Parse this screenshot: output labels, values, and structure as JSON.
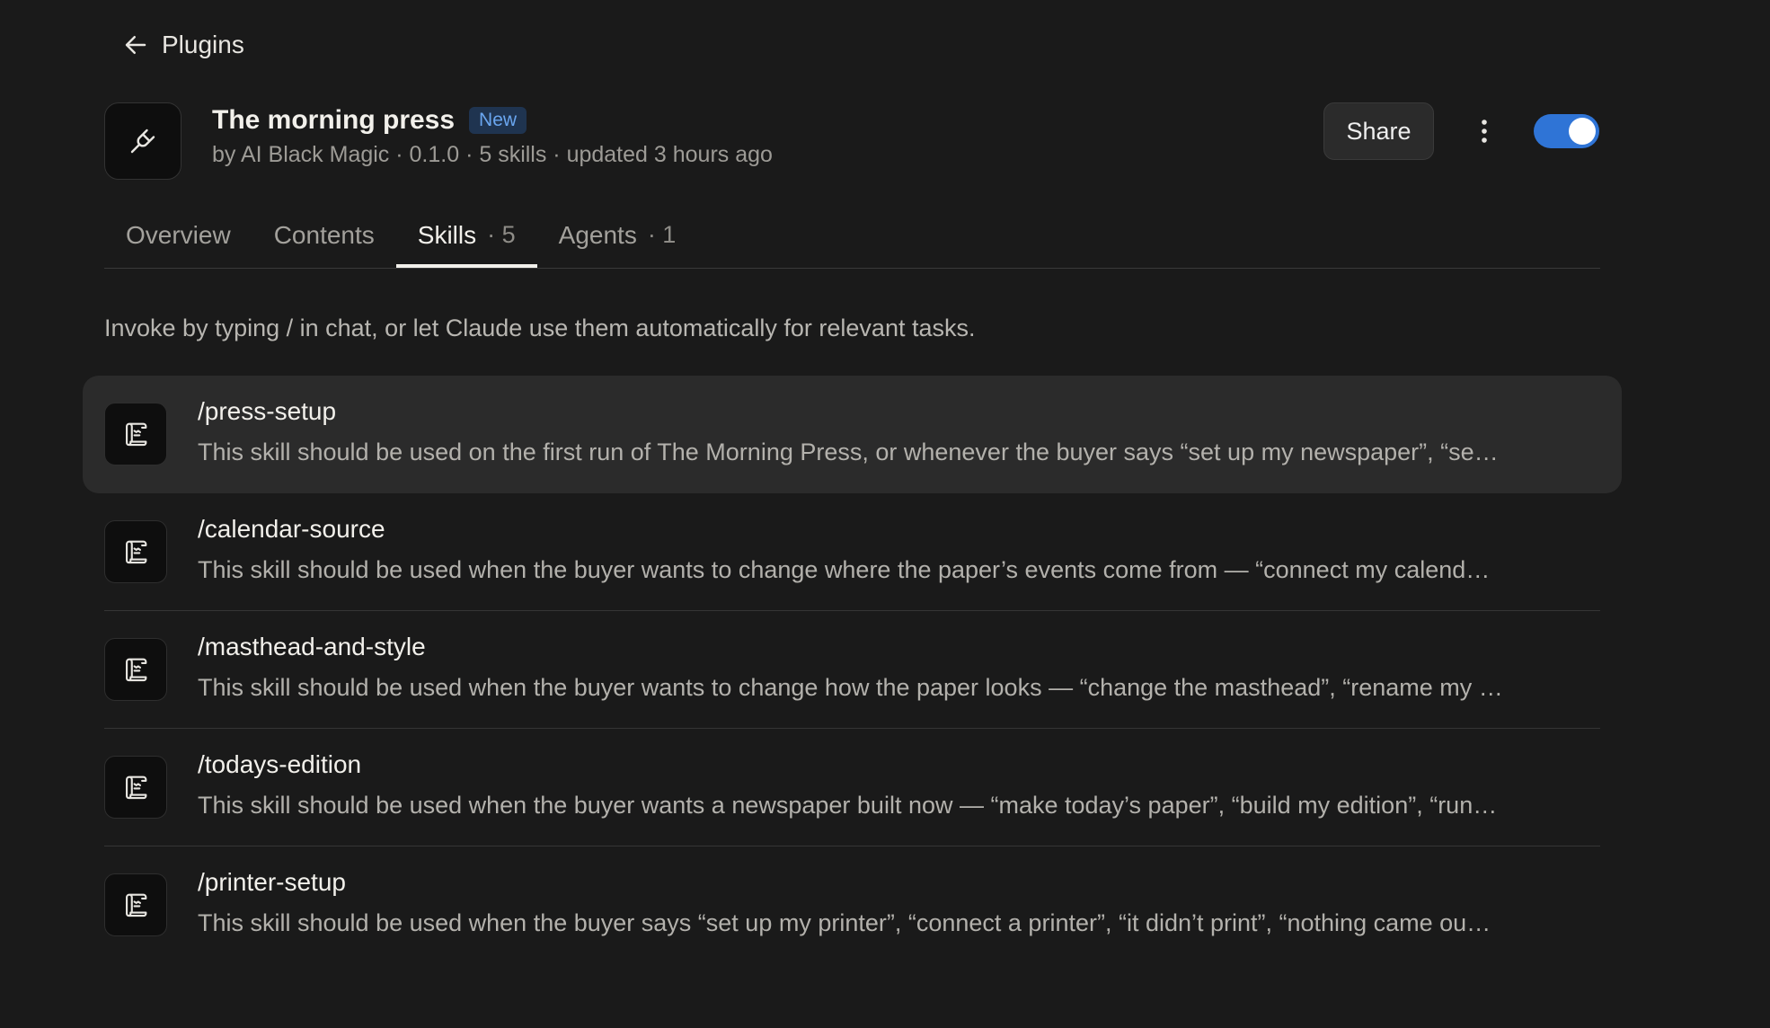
{
  "nav": {
    "back_label": "Plugins"
  },
  "plugin": {
    "icon": "plug-icon",
    "title": "The morning press",
    "badge": "New",
    "meta": "by AI Black Magic · 0.1.0 · 5 skills · updated 3 hours ago",
    "enabled": true
  },
  "actions": {
    "share_label": "Share"
  },
  "tabs": [
    {
      "label": "Overview",
      "count": ""
    },
    {
      "label": "Contents",
      "count": ""
    },
    {
      "label": "Skills",
      "count": "· 5",
      "active": true
    },
    {
      "label": "Agents",
      "count": "· 1"
    }
  ],
  "intro": "Invoke by typing / in chat, or let Claude use them automatically for relevant tasks.",
  "skills": [
    {
      "name": "/press-setup",
      "desc": "This skill should be used on the first run of The Morning Press, or whenever the buyer says “set up my newspaper”, “se…"
    },
    {
      "name": "/calendar-source",
      "desc": "This skill should be used when the buyer wants to change where the paper’s events come from — “connect my calend…"
    },
    {
      "name": "/masthead-and-style",
      "desc": "This skill should be used when the buyer wants to change how the paper looks — “change the masthead”, “rename my …"
    },
    {
      "name": "/todays-edition",
      "desc": "This skill should be used when the buyer wants a newspaper built now — “make today’s paper”, “build my edition”, “run…"
    },
    {
      "name": "/printer-setup",
      "desc": "This skill should be used when the buyer says “set up my printer”, “connect a printer”, “it didn’t print”, “nothing came ou…"
    }
  ],
  "colors": {
    "accent": "#2f74d6",
    "badge_text": "#6aa6ef",
    "background": "#1a1a1a"
  }
}
